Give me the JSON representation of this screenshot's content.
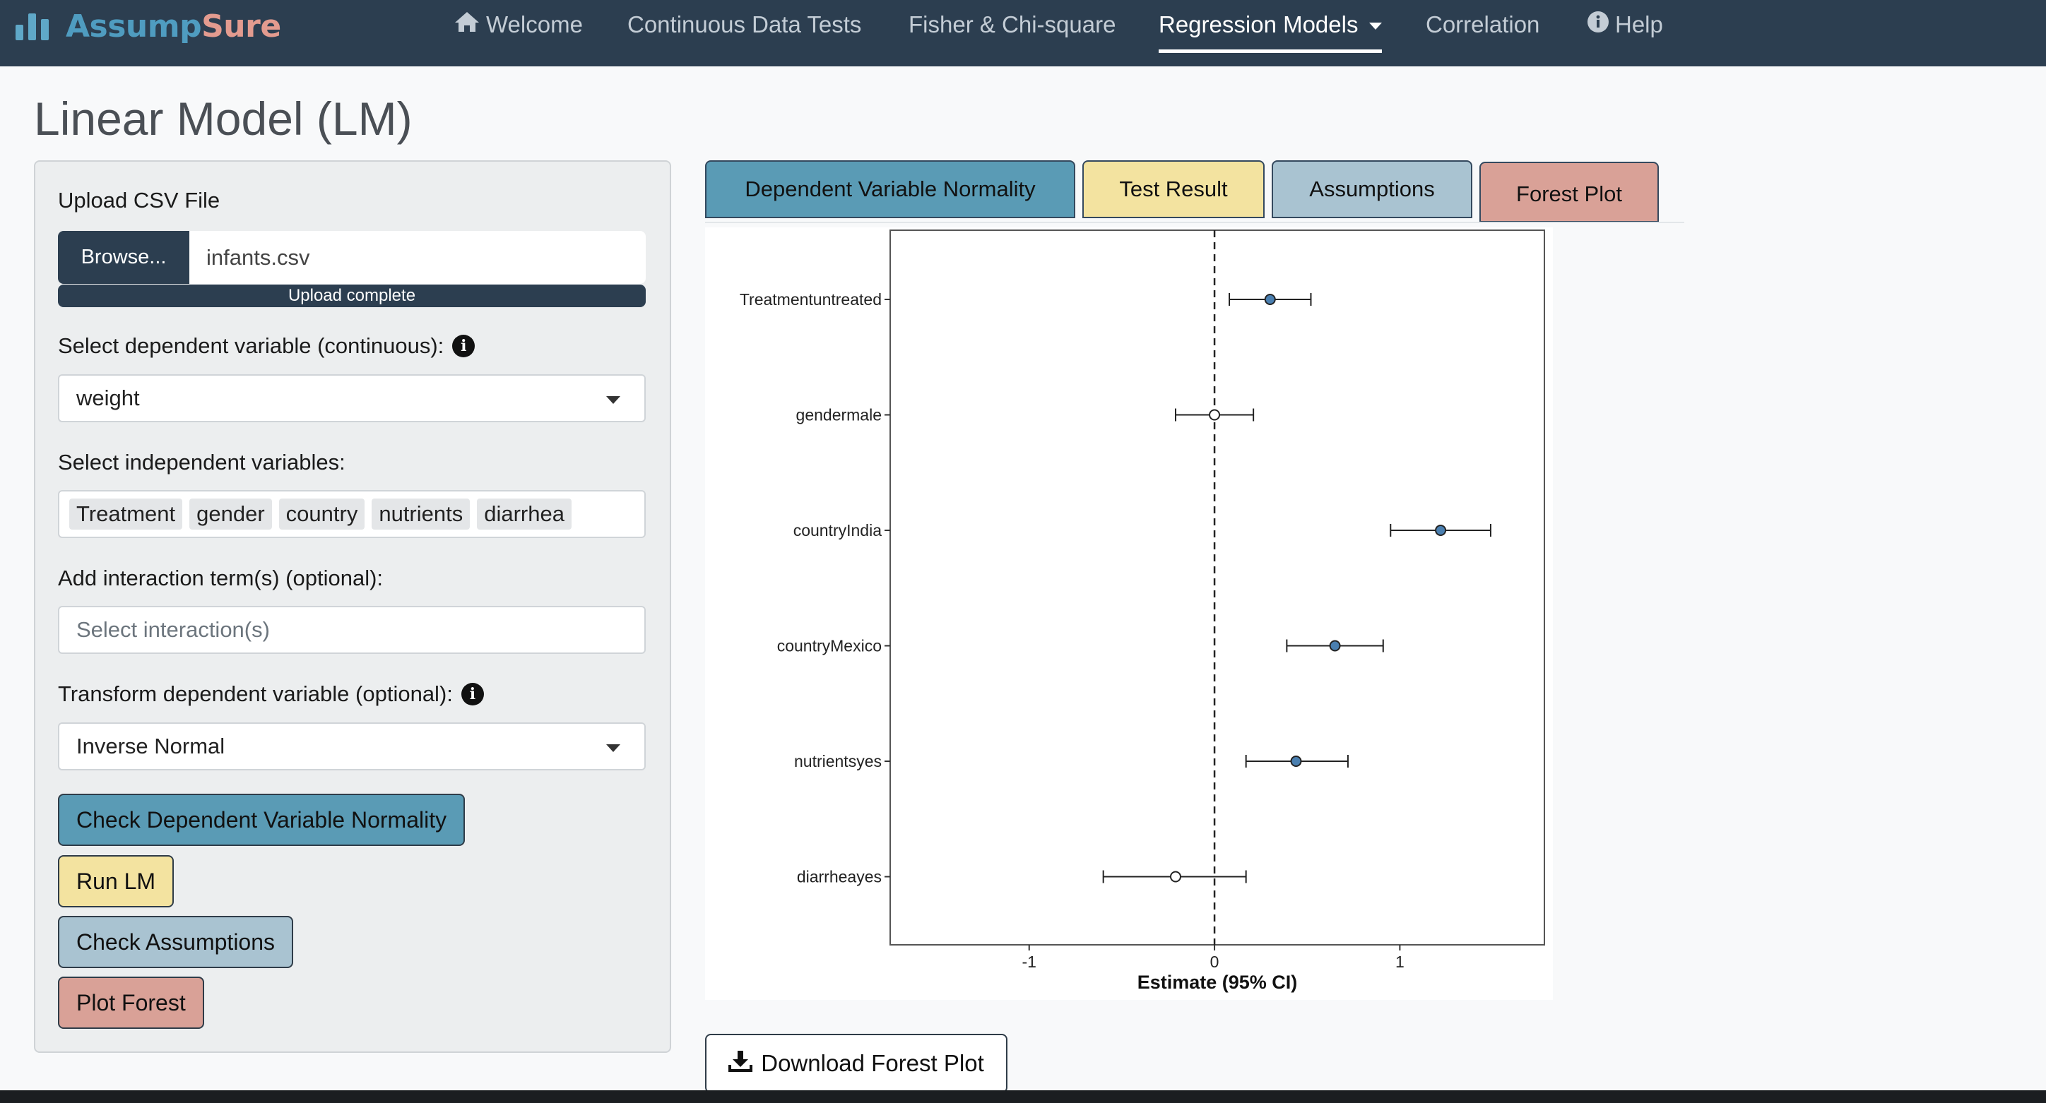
{
  "app": {
    "brand_part1": "Assump",
    "brand_part2": "Sure"
  },
  "nav": {
    "items": [
      {
        "label": "Welcome",
        "icon": "home-icon"
      },
      {
        "label": "Continuous Data Tests"
      },
      {
        "label": "Fisher & Chi-square"
      },
      {
        "label": "Regression Models",
        "active": true,
        "dropdown": true
      },
      {
        "label": "Correlation"
      },
      {
        "label": "Help",
        "icon": "info-circle-icon"
      }
    ]
  },
  "page": {
    "title": "Linear Model (LM)"
  },
  "sidebar": {
    "upload_label": "Upload CSV File",
    "browse_label": "Browse...",
    "file_name": "infants.csv",
    "upload_status": "Upload complete",
    "dep_var_label": "Select dependent variable (continuous):",
    "dep_var_value": "weight",
    "indep_label": "Select independent variables:",
    "indep_values": [
      "Treatment",
      "gender",
      "country",
      "nutrients",
      "diarrhea"
    ],
    "interaction_label": "Add interaction term(s) (optional):",
    "interaction_placeholder": "Select interaction(s)",
    "transform_label": "Transform dependent variable (optional):",
    "transform_value": "Inverse Normal",
    "buttons": {
      "check_normality": "Check Dependent Variable Normality",
      "run_lm": "Run LM",
      "check_assumptions": "Check Assumptions",
      "plot_forest": "Plot Forest"
    }
  },
  "tabs": [
    {
      "label": "Dependent Variable Normality",
      "color": "#5a9bb5"
    },
    {
      "label": "Test Result",
      "color": "#f3e3a0"
    },
    {
      "label": "Assumptions",
      "color": "#a9c3d1"
    },
    {
      "label": "Forest Plot",
      "color": "#d9a197",
      "active": true
    }
  ],
  "download": {
    "label": "Download Forest Plot"
  },
  "colors": {
    "navbar": "#2c3e50",
    "sig_point": "#4a7fb0",
    "nonsig_point": "#ffffff"
  },
  "chart_data": {
    "type": "scatter",
    "subtype": "forest",
    "xlabel": "Estimate (95% CI)",
    "xlim": [
      -1.75,
      1.78
    ],
    "x_ticks": [
      "-1",
      "0",
      "1"
    ],
    "reference_line_x": 0,
    "grid": false,
    "terms": [
      {
        "name": "Treatmentuntreated",
        "estimate": 0.3,
        "lower": 0.08,
        "upper": 0.52,
        "significant": true
      },
      {
        "name": "gendermale",
        "estimate": 0.0,
        "lower": -0.21,
        "upper": 0.21,
        "significant": false
      },
      {
        "name": "countryIndia",
        "estimate": 1.22,
        "lower": 0.95,
        "upper": 1.49,
        "significant": true
      },
      {
        "name": "countryMexico",
        "estimate": 0.65,
        "lower": 0.39,
        "upper": 0.91,
        "significant": true
      },
      {
        "name": "nutrientsyes",
        "estimate": 0.44,
        "lower": 0.17,
        "upper": 0.72,
        "significant": true
      },
      {
        "name": "diarrheayes",
        "estimate": -0.21,
        "lower": -0.6,
        "upper": 0.17,
        "significant": false
      }
    ]
  }
}
